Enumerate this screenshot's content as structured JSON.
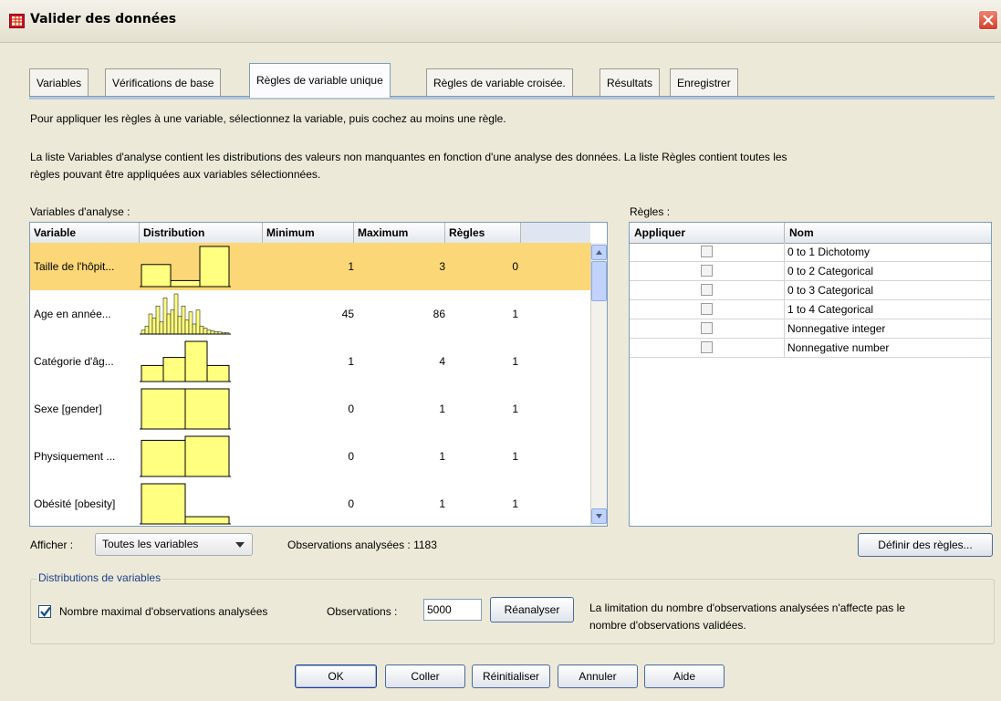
{
  "window": {
    "title": "Valider des données",
    "app_icon": "spss-data-grid-icon",
    "close_icon": "close-icon"
  },
  "tabs": [
    {
      "label": "Variables",
      "active": false
    },
    {
      "label": "Vérifications de base",
      "active": false
    },
    {
      "label": "Règles de variable unique",
      "active": true
    },
    {
      "label": "Règles de variable croisée.",
      "active": false
    },
    {
      "label": "Résultats",
      "active": false
    },
    {
      "label": "Enregistrer",
      "active": false
    }
  ],
  "instructions": {
    "line1": "Pour appliquer les règles à une variable, sélectionnez la variable, puis cochez au moins une règle.",
    "line2a": "La liste Variables d'analyse contient les distributions des valeurs non manquantes en fonction d'une analyse des données. La liste Règles contient toutes les",
    "line2b": "règles pouvant être appliquées aux variables sélectionnées."
  },
  "variables_panel": {
    "label": "Variables d'analyse :",
    "columns": [
      "Variable",
      "Distribution",
      "Minimum",
      "Maximum",
      "Règles"
    ],
    "rows": [
      {
        "name": "Taille de l'hôpit...",
        "min": "1",
        "max": "3",
        "rules": "0",
        "selected": true,
        "dist": [
          0.55,
          0.15,
          1.0
        ]
      },
      {
        "name": "Age en année...",
        "min": "45",
        "max": "86",
        "rules": "1",
        "selected": false,
        "dist": [
          0.1,
          0.2,
          0.5,
          0.4,
          0.7,
          0.3,
          0.9,
          0.5,
          0.6,
          1.0,
          0.45,
          0.7,
          0.35,
          0.55,
          0.25,
          0.6,
          0.2,
          0.15,
          0.1,
          0.08,
          0.06,
          0.05,
          0.04,
          0.03
        ]
      },
      {
        "name": "Catégorie d'âg...",
        "min": "1",
        "max": "4",
        "rules": "1",
        "selected": false,
        "dist": [
          0.4,
          0.6,
          1.0,
          0.4
        ]
      },
      {
        "name": "Sexe [gender]",
        "min": "0",
        "max": "1",
        "rules": "1",
        "selected": false,
        "dist": [
          1.0,
          1.0
        ]
      },
      {
        "name": "Physiquement ...",
        "min": "0",
        "max": "1",
        "rules": "1",
        "selected": false,
        "dist": [
          0.9,
          1.0
        ]
      },
      {
        "name": "Obésité [obesity]",
        "min": "0",
        "max": "1",
        "rules": "1",
        "selected": false,
        "dist": [
          1.0,
          0.18
        ]
      }
    ]
  },
  "rules_panel": {
    "label": "Règles :",
    "columns": [
      "Appliquer",
      "Nom"
    ],
    "rows": [
      {
        "name": "0 to 1 Dichotomy",
        "checked": false
      },
      {
        "name": "0 to 2 Categorical",
        "checked": false
      },
      {
        "name": "0 to 3 Categorical",
        "checked": false
      },
      {
        "name": "1 to 4 Categorical",
        "checked": false
      },
      {
        "name": "Nonnegative integer",
        "checked": false
      },
      {
        "name": "Nonnegative number",
        "checked": false
      }
    ]
  },
  "display": {
    "label": "Afficher :",
    "selected": "Toutes les variables",
    "observations_scanned": "Observations analysées : 1183"
  },
  "define_rules_button": "Définir des règles...",
  "distributions_group": {
    "title": "Distributions de variables",
    "max_obs_checkbox_label": "Nombre maximal d'observations analysées",
    "max_obs_checked": true,
    "observations_label": "Observations :",
    "observations_value": "5000",
    "rescan_button": "Réanalyser",
    "note_line1": "La limitation du nombre d'observations analysées n'affecte pas le",
    "note_line2": "nombre d'observations validées."
  },
  "footer_buttons": {
    "ok": "OK",
    "paste": "Coller",
    "reset": "Réinitialiser",
    "cancel": "Annuler",
    "help": "Aide"
  },
  "colors": {
    "selected_row": "#fcd778",
    "histogram_fill": "#ffff80",
    "accent_blue": "#7f9db9"
  }
}
